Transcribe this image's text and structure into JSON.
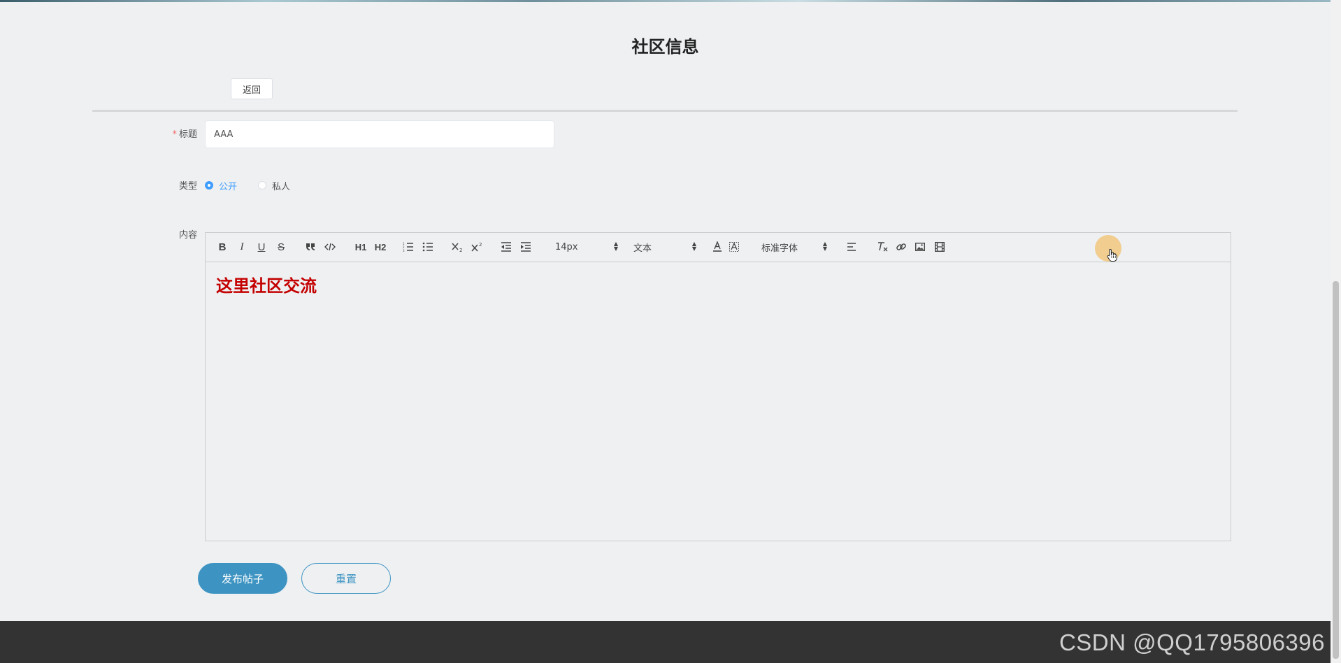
{
  "page": {
    "title": "社区信息",
    "back_label": "返回"
  },
  "form": {
    "title_label": "标题",
    "required_mark": "*",
    "title_value": "AAA",
    "type_label": "类型",
    "type_options": [
      "公开",
      "私人"
    ],
    "type_selected": "公开",
    "content_label": "内容"
  },
  "editor": {
    "toolbar": {
      "font_size": "14px",
      "header_style": "文本",
      "font_family": "标准字体",
      "h1": "H1",
      "h2": "H2",
      "bold": "B",
      "italic": "I",
      "underline": "U",
      "strike": "S"
    },
    "content_text": "这里社区交流"
  },
  "actions": {
    "publish_label": "发布帖子",
    "reset_label": "重置"
  },
  "footer": {
    "watermark": "CSDN @QQ1795806396"
  },
  "colors": {
    "accent": "#3d94c2",
    "radio_active": "#409eff",
    "content_text": "#c40000",
    "footer_bg": "#333333"
  }
}
